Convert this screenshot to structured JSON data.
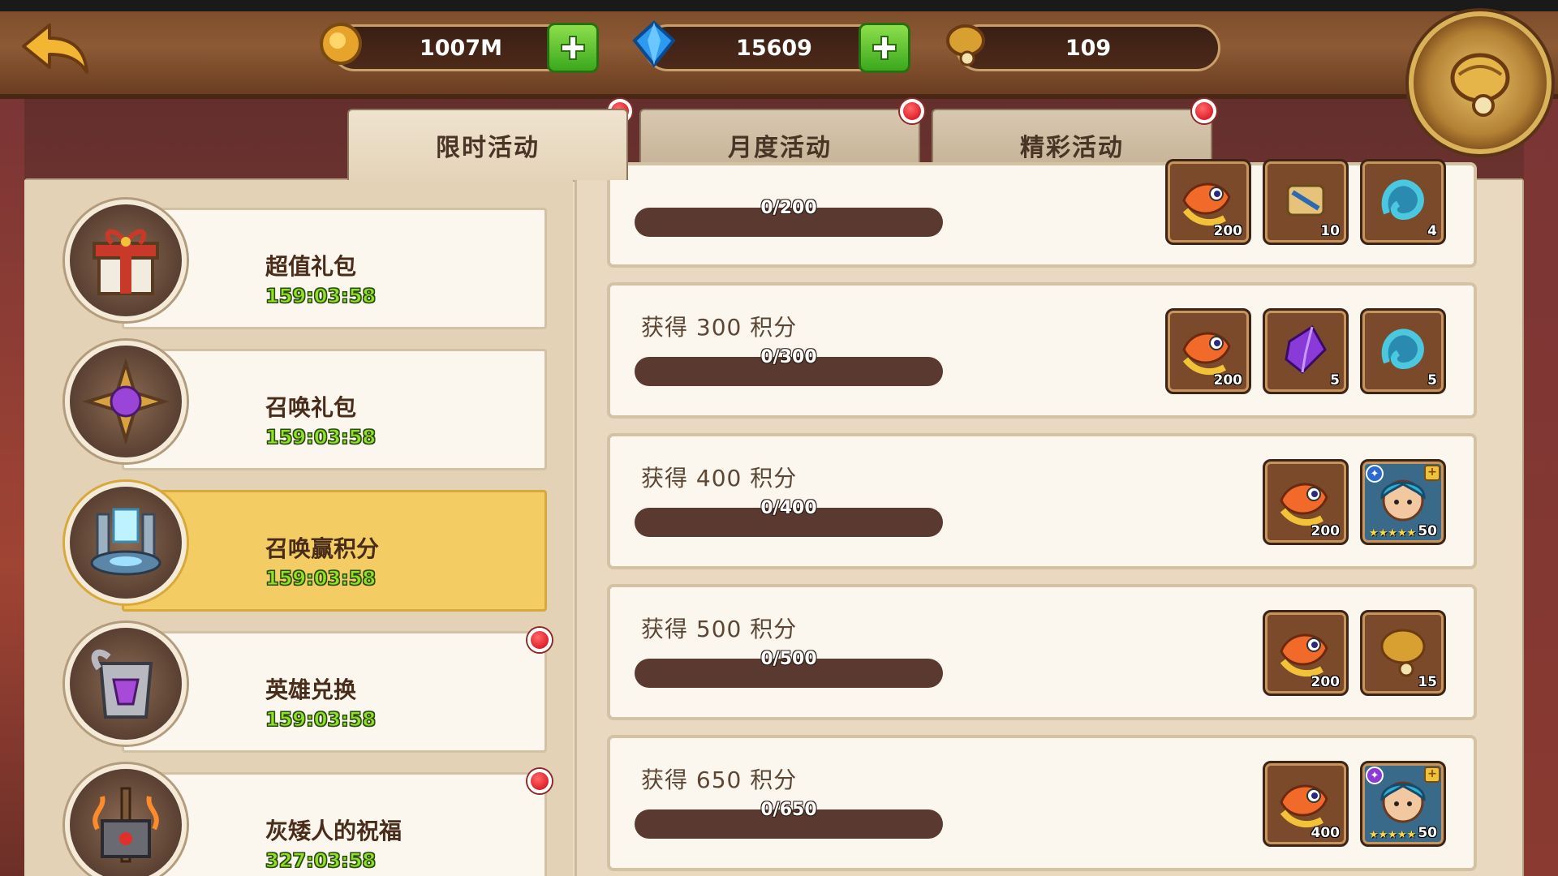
{
  "topbar": {
    "gold": "1007M",
    "diamonds": "15609",
    "summon_orbs": "109"
  },
  "tabs": [
    {
      "label": "限时活动",
      "active": true,
      "badge": true
    },
    {
      "label": "月度活动",
      "active": false,
      "badge": true
    },
    {
      "label": "精彩活动",
      "active": false,
      "badge": true
    }
  ],
  "activities": [
    {
      "name": "超值礼包",
      "timer": "159:03:58",
      "icon": "gift-box-icon",
      "selected": false,
      "badge": false
    },
    {
      "name": "召唤礼包",
      "timer": "159:03:58",
      "icon": "summon-star-icon",
      "selected": false,
      "badge": false
    },
    {
      "name": "召唤赢积分",
      "timer": "159:03:58",
      "icon": "summon-altar-icon",
      "selected": true,
      "badge": false
    },
    {
      "name": "英雄兑换",
      "timer": "159:03:58",
      "icon": "hero-exchange-icon",
      "selected": false,
      "badge": true
    },
    {
      "name": "灰矮人的祝福",
      "timer": "327:03:58",
      "icon": "dwarf-hammer-icon",
      "selected": false,
      "badge": true
    }
  ],
  "rewards": [
    {
      "label": "",
      "progress": "0/200",
      "fraction": 0,
      "items": [
        {
          "icon": "fish-icon",
          "count": "200"
        },
        {
          "icon": "scroll-icon",
          "count": "10"
        },
        {
          "icon": "spirit-icon",
          "count": "4"
        }
      ]
    },
    {
      "label": "获得  300 积分",
      "progress": "0/300",
      "fraction": 0,
      "items": [
        {
          "icon": "fish-icon",
          "count": "200"
        },
        {
          "icon": "purple-gem-icon",
          "count": "5"
        },
        {
          "icon": "spirit-icon",
          "count": "5"
        }
      ]
    },
    {
      "label": "获得  400 积分",
      "progress": "0/400",
      "fraction": 0,
      "items": [
        {
          "icon": "fish-icon",
          "count": "200"
        },
        {
          "icon": "hero-portrait-icon",
          "count": "50"
        }
      ]
    },
    {
      "label": "获得  500 积分",
      "progress": "0/500",
      "fraction": 0,
      "items": [
        {
          "icon": "fish-icon",
          "count": "200"
        },
        {
          "icon": "summon-orb-icon",
          "count": "15"
        }
      ]
    },
    {
      "label": "获得  650 积分",
      "progress": "0/650",
      "fraction": 0,
      "items": [
        {
          "icon": "fish-icon",
          "count": "400"
        },
        {
          "icon": "hero-portrait-icon",
          "count": "50"
        }
      ]
    }
  ],
  "colors": {
    "accent_selected": "#f3cd63",
    "timer_green": "#8fe02a",
    "badge_red": "#e0212a"
  }
}
